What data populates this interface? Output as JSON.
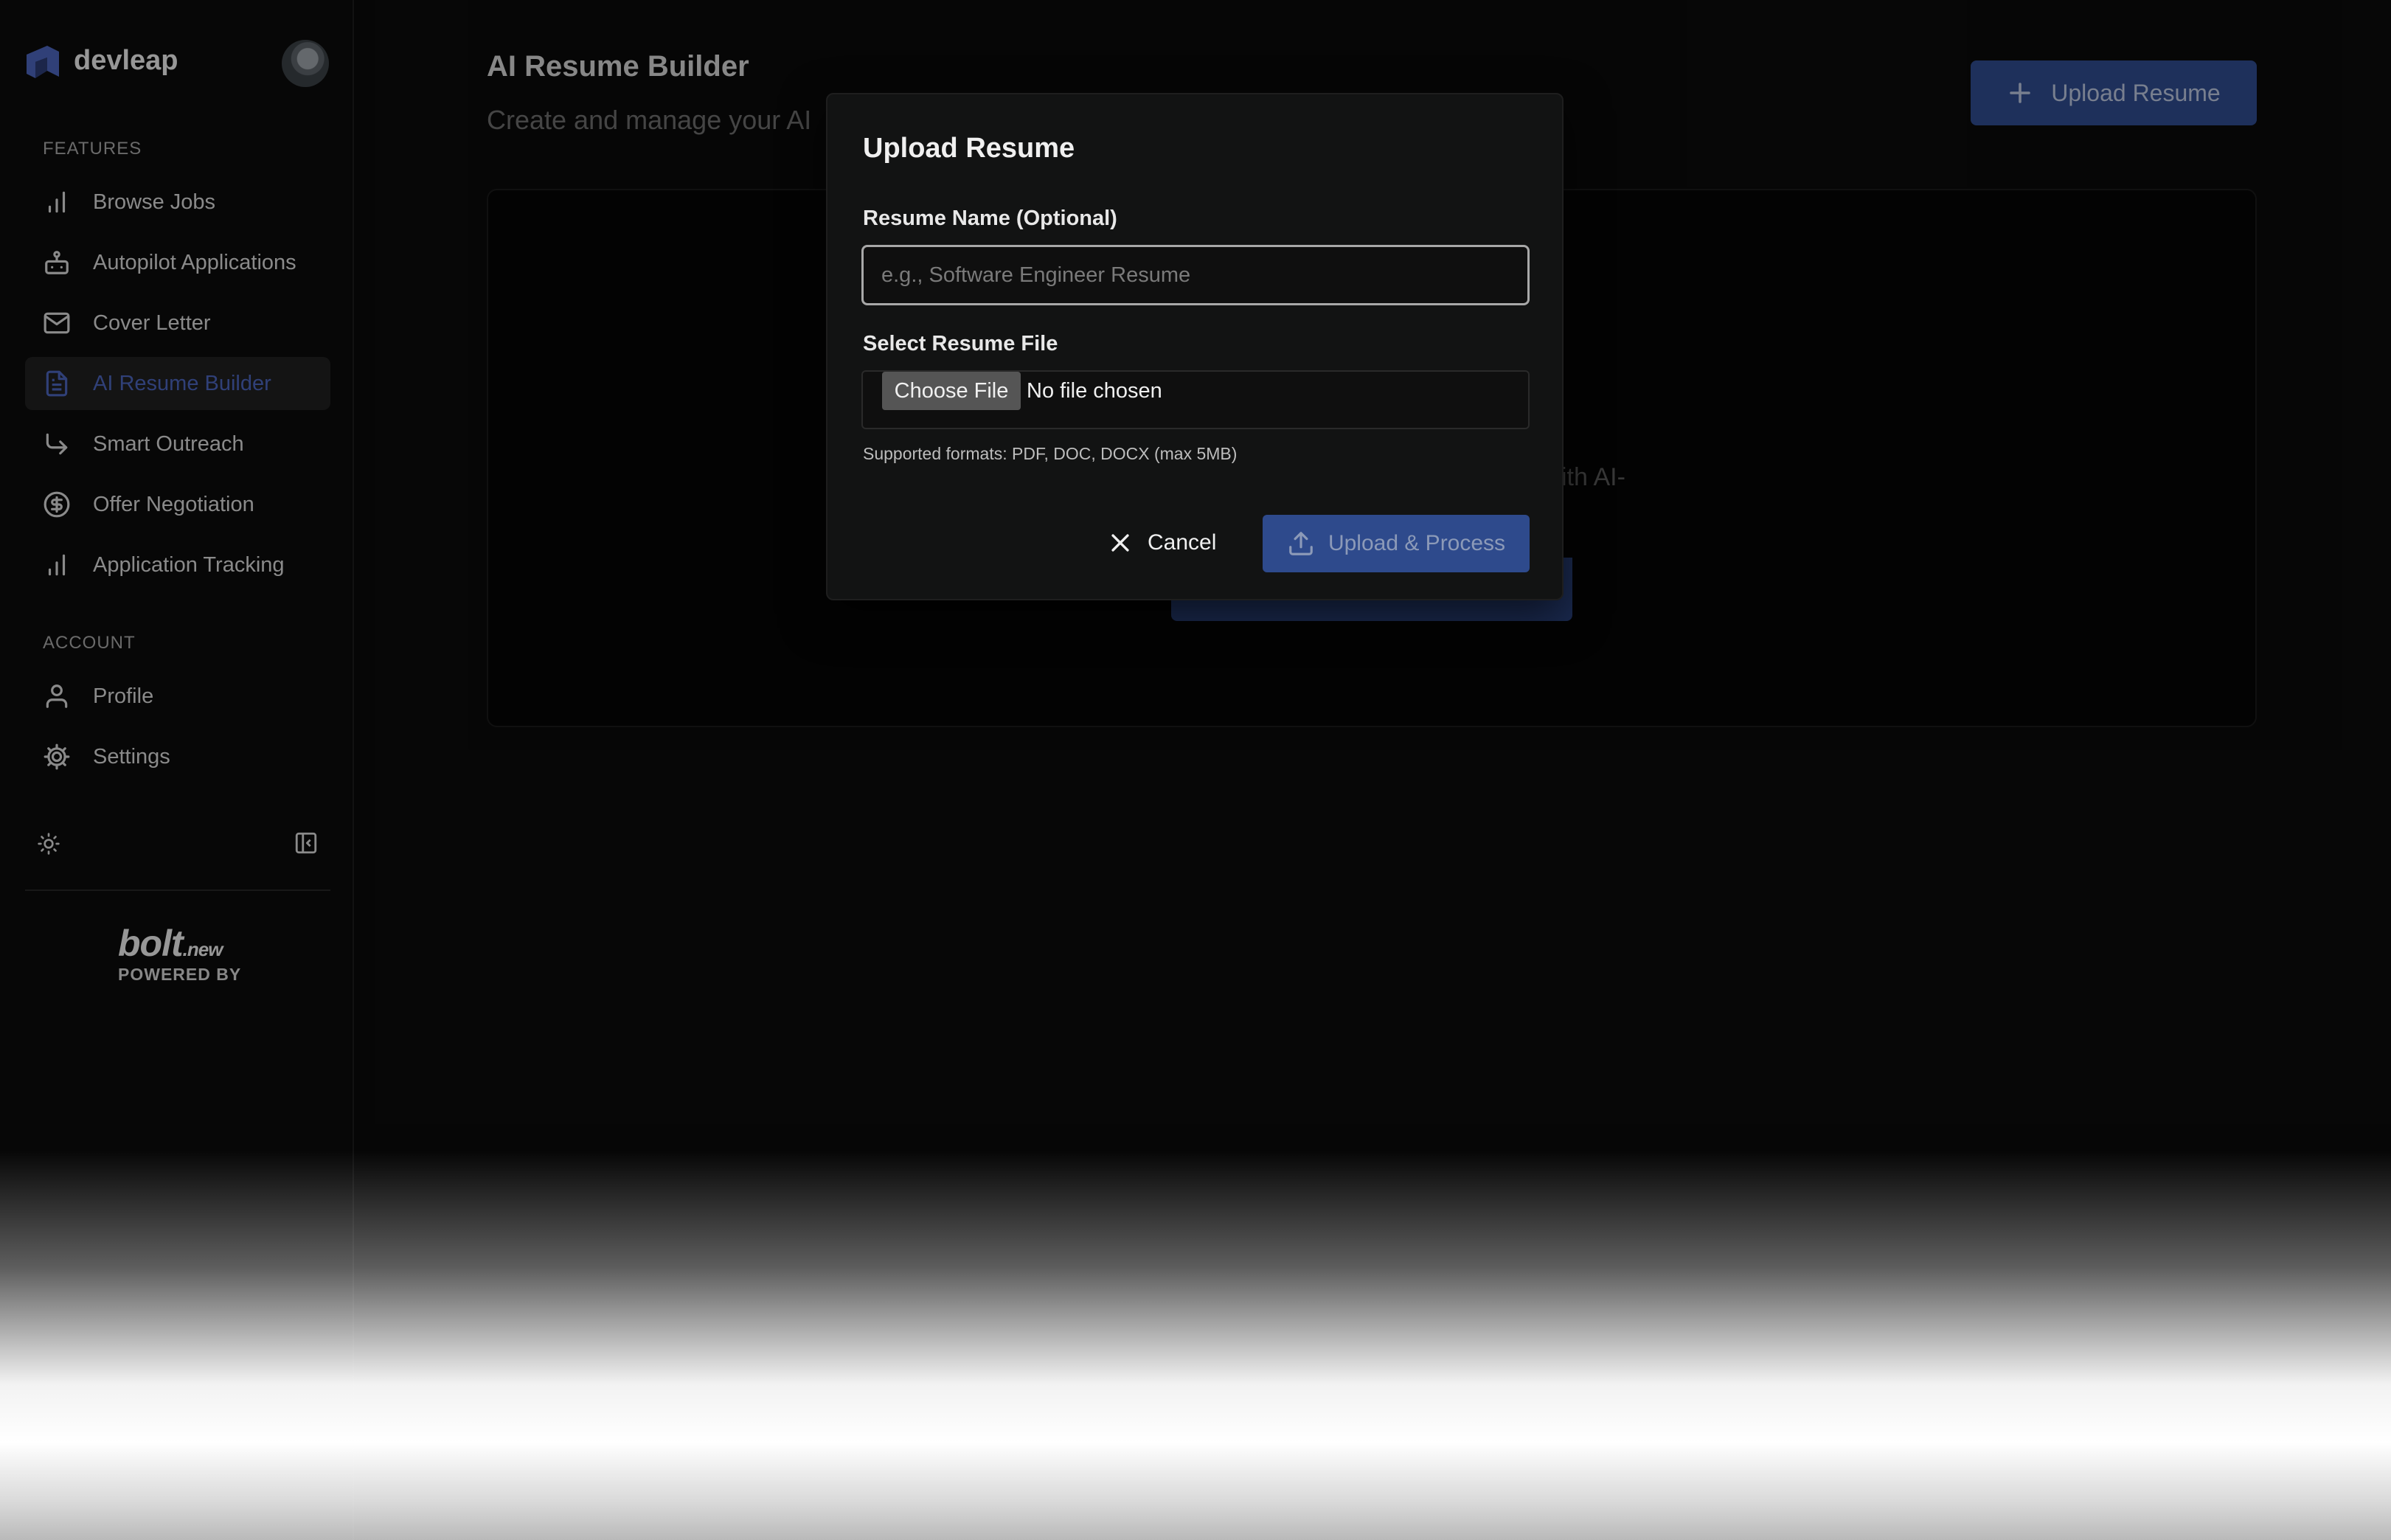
{
  "app": {
    "brand": "devleap"
  },
  "sidebar": {
    "features_label": "FEATURES",
    "account_label": "ACCOUNT",
    "features": [
      {
        "label": "Browse Jobs",
        "icon": "bar-chart-icon"
      },
      {
        "label": "Autopilot Applications",
        "icon": "robot-icon"
      },
      {
        "label": "Cover Letter",
        "icon": "mail-icon"
      },
      {
        "label": "AI Resume Builder",
        "icon": "file-text-icon",
        "active": true
      },
      {
        "label": "Smart Outreach",
        "icon": "forward-arrow-icon"
      },
      {
        "label": "Offer Negotiation",
        "icon": "dollar-circle-icon"
      },
      {
        "label": "Application Tracking",
        "icon": "bar-chart-icon"
      }
    ],
    "account": [
      {
        "label": "Profile",
        "icon": "user-icon"
      },
      {
        "label": "Settings",
        "icon": "gear-icon"
      }
    ],
    "footer": {
      "logo": "bolt",
      "logo_suffix": ".new",
      "powered_by": "POWERED BY"
    }
  },
  "main": {
    "title": "AI Resume Builder",
    "subtitle": "Create and manage your AI",
    "upload_button": "Upload Resume",
    "card_text_fragment": "vith AI-"
  },
  "modal": {
    "title": "Upload Resume",
    "name_label": "Resume Name (Optional)",
    "name_placeholder": "e.g., Software Engineer Resume",
    "name_value": "",
    "file_label": "Select Resume File",
    "choose_file": "Choose File",
    "file_status": "No file chosen",
    "formats_note": "Supported formats: PDF, DOC, DOCX (max 5MB)",
    "cancel": "Cancel",
    "submit": "Upload & Process"
  },
  "colors": {
    "accent": "#2e4a8c",
    "active_nav_text": "#4a63b8",
    "background": "#0a0a0a"
  }
}
